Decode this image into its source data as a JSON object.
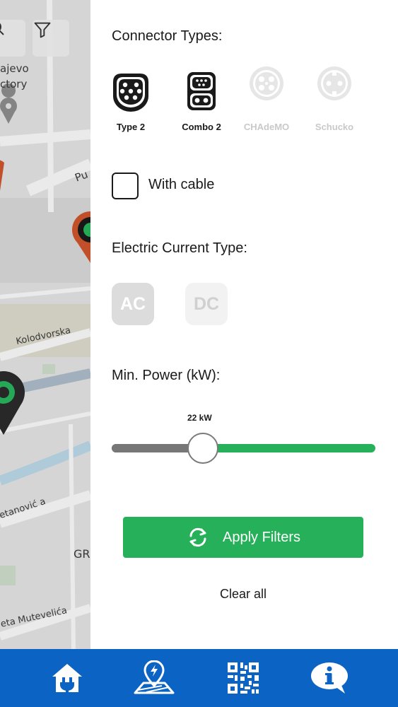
{
  "map": {
    "labels": [
      {
        "id": "sarajevo",
        "text": "ajevo"
      },
      {
        "id": "factory",
        "text": "ctory"
      },
      {
        "id": "street-pu",
        "text": "Pu"
      },
      {
        "id": "kolodvorska",
        "text": "Kolodvorska"
      },
      {
        "id": "etanovica",
        "text": "etanović a"
      },
      {
        "id": "gr",
        "text": "GR"
      },
      {
        "id": "mutevelica",
        "text": "eta Mutevelića"
      }
    ]
  },
  "filters": {
    "connector_title": "Connector Types:",
    "connectors": [
      {
        "label": "Type 2",
        "active": true,
        "icon": "type2-plug-icon"
      },
      {
        "label": "Combo 2",
        "active": true,
        "icon": "combo2-plug-icon"
      },
      {
        "label": "CHAdeMO",
        "active": false,
        "icon": "chademo-plug-icon"
      },
      {
        "label": "Schucko",
        "active": false,
        "icon": "schuko-plug-icon"
      }
    ],
    "cable_label": "With cable",
    "current_title": "Electric Current Type:",
    "current_ac": "AC",
    "current_dc": "DC",
    "power_title": "Min. Power (kW):",
    "power_value_label": "22 kW",
    "power_fraction": 0.345,
    "apply_label": "Apply Filters",
    "clear_label": "Clear all"
  },
  "colors": {
    "accent_green": "#27b05a",
    "nav_blue": "#0b63c4"
  },
  "nav": {
    "items": [
      {
        "name": "home-charger-icon"
      },
      {
        "name": "map-location-icon"
      },
      {
        "name": "qr-code-icon"
      },
      {
        "name": "info-chat-icon"
      }
    ]
  }
}
